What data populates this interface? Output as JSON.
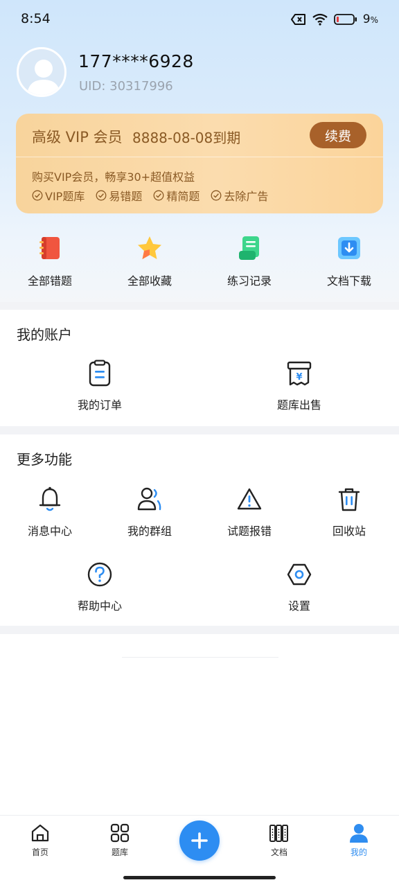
{
  "status_bar": {
    "time": "8:54",
    "battery": "9",
    "battery_unit": "%"
  },
  "profile": {
    "phone": "177****6928",
    "uid": "UID: 30317996"
  },
  "vip": {
    "title": "高级 VIP 会员",
    "expire": "8888-08-08到期",
    "renew_label": "续费",
    "description": "购买VIP会员，畅享30+超值权益",
    "benefits": [
      "VIP题库",
      "易错题",
      "精简题",
      "去除广告"
    ]
  },
  "quick_actions": [
    {
      "label": "全部错题",
      "icon": "notebook-icon"
    },
    {
      "label": "全部收藏",
      "icon": "star-icon"
    },
    {
      "label": "练习记录",
      "icon": "record-icon"
    },
    {
      "label": "文档下载",
      "icon": "download-icon"
    }
  ],
  "account": {
    "title": "我的账户",
    "items": [
      {
        "label": "我的订单",
        "icon": "order-icon"
      },
      {
        "label": "题库出售",
        "icon": "sale-icon"
      }
    ]
  },
  "more": {
    "title": "更多功能",
    "items": [
      {
        "label": "消息中心",
        "icon": "bell-icon"
      },
      {
        "label": "我的群组",
        "icon": "group-icon"
      },
      {
        "label": "试题报错",
        "icon": "warning-icon"
      },
      {
        "label": "回收站",
        "icon": "trash-icon"
      },
      {
        "label": "帮助中心",
        "icon": "help-icon"
      },
      {
        "label": "设置",
        "icon": "settings-icon"
      }
    ]
  },
  "tabs": [
    {
      "label": "首页",
      "icon": "home-icon"
    },
    {
      "label": "题库",
      "icon": "grid-icon"
    },
    {
      "label": "文档",
      "icon": "books-icon"
    },
    {
      "label": "我的",
      "icon": "user-icon",
      "active": true
    }
  ],
  "colors": {
    "accent": "#2d8df2",
    "vip_text": "#8a5a25",
    "renew_button": "#a8612a"
  }
}
